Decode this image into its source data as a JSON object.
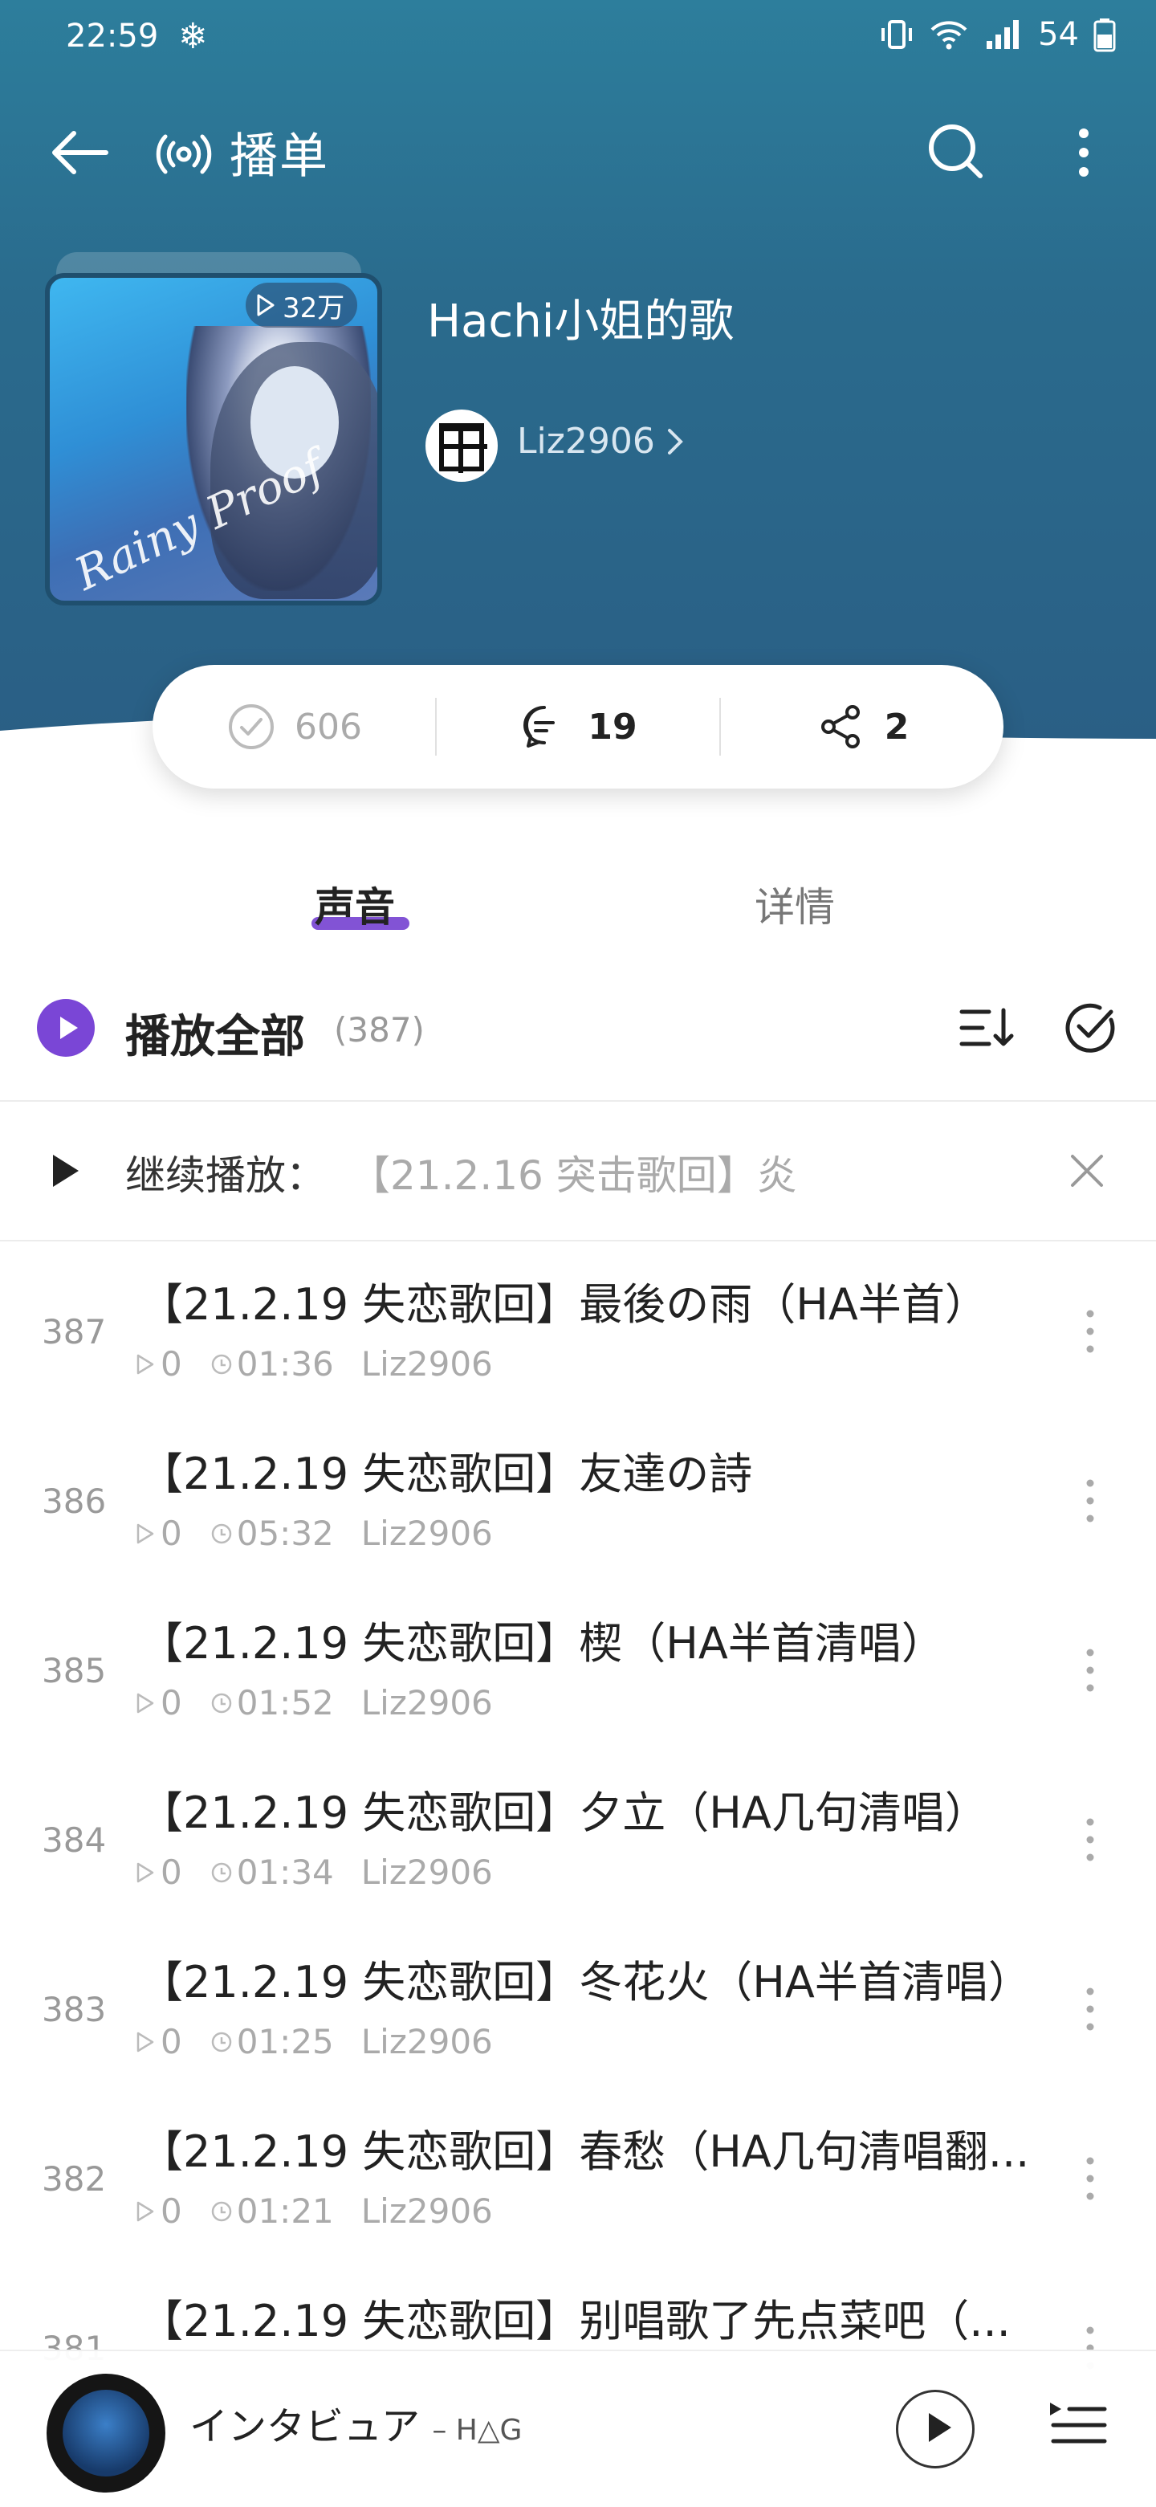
{
  "status": {
    "time": "22:59",
    "snow_glyph": "❄",
    "battery": "54"
  },
  "header": {
    "title": "播单"
  },
  "album": {
    "play_count": "32万",
    "title": "Hachi小姐的歌",
    "owner": "Liz2906",
    "cover_signature": "Rainy Proof"
  },
  "stats": {
    "likes": "606",
    "comments": "19",
    "shares": "2"
  },
  "tabs": [
    {
      "label": "声音"
    },
    {
      "label": "详情"
    }
  ],
  "playall": {
    "label": "播放全部",
    "count": "(387)"
  },
  "continue": {
    "label": "继续播放：",
    "track": "【21.2.16 突击歌回】炎"
  },
  "tracks": [
    {
      "num": "387",
      "title": "【21.2.19 失恋歌回】最後の雨（HA半首）",
      "plays": "0",
      "duration": "01:36",
      "uploader": "Liz2906"
    },
    {
      "num": "386",
      "title": "【21.2.19 失恋歌回】友達の詩",
      "plays": "0",
      "duration": "05:32",
      "uploader": "Liz2906"
    },
    {
      "num": "385",
      "title": "【21.2.19 失恋歌回】楔（HA半首清唱）",
      "plays": "0",
      "duration": "01:52",
      "uploader": "Liz2906"
    },
    {
      "num": "384",
      "title": "【21.2.19 失恋歌回】夕立（HA几句清唱）",
      "plays": "0",
      "duration": "01:34",
      "uploader": "Liz2906"
    },
    {
      "num": "383",
      "title": "【21.2.19 失恋歌回】冬花火（HA半首清唱）",
      "plays": "0",
      "duration": "01:25",
      "uploader": "Liz2906"
    },
    {
      "num": "382",
      "title": "【21.2.19 失恋歌回】春愁（HA几句清唱翻...",
      "plays": "0",
      "duration": "01:21",
      "uploader": "Liz2906"
    },
    {
      "num": "381",
      "title": "【21.2.19 失恋歌回】别唱歌了先点菜吧（...",
      "plays": "",
      "duration": "",
      "uploader": ""
    }
  ],
  "mini_player": {
    "song": "インタビュア",
    "artist": "– H△G"
  },
  "colors": {
    "accent": "#7440d0",
    "header": "#2a6b8d"
  }
}
